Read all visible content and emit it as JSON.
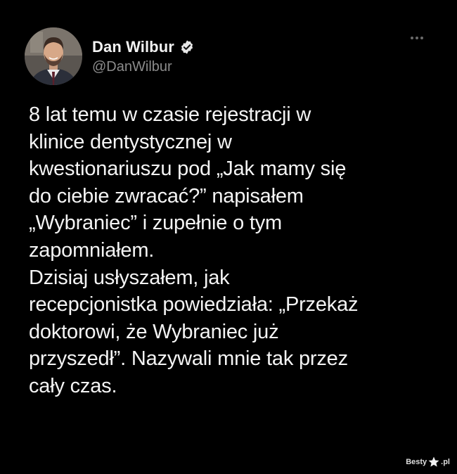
{
  "tweet": {
    "author": {
      "display_name": "Dan Wilbur",
      "handle": "@DanWilbur",
      "verified_icon": "verified-badge-icon",
      "avatar": "avatar-photo"
    },
    "more_icon": "more-horizontal-icon",
    "text": "8 lat temu w czasie rejestracji w\nklinice dentystycznej w\nkwestionariuszu pod „Jak mamy się\ndo ciebie zwracać?” napisałem\n„Wybraniec” i zupełnie o tym\nzapomniałem.\nDzisiaj usłyszałem, jak\nrecepcjonistka powiedziała: „Przekaż\ndoktorowi, że Wybraniec już\nprzyszedł”. Nazywali mnie tak przez\ncały czas."
  },
  "watermark": {
    "left": "Besty",
    "right": ".pl"
  },
  "colors": {
    "background": "#000000",
    "text": "#f4f4f4",
    "handle": "#8b8b8b"
  }
}
